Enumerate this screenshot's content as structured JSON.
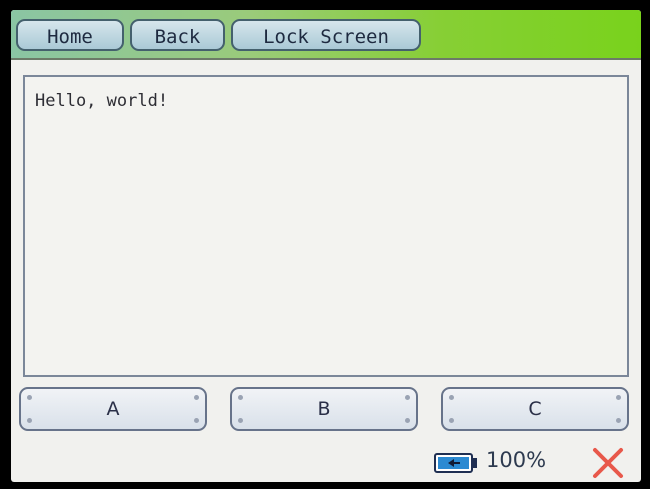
{
  "topbar": {
    "home_label": "Home",
    "back_label": "Back",
    "lock_label": "Lock Screen"
  },
  "textarea": {
    "value": "Hello, world!"
  },
  "buttons": {
    "a_label": "A",
    "b_label": "B",
    "c_label": "C"
  },
  "status": {
    "battery_icon": "battery-icon",
    "battery_percent": "100%",
    "close_icon": "close-icon"
  },
  "colors": {
    "topbar_accent": "#79d21c",
    "close_red": "#e8584a",
    "button_border": "#67738a"
  }
}
